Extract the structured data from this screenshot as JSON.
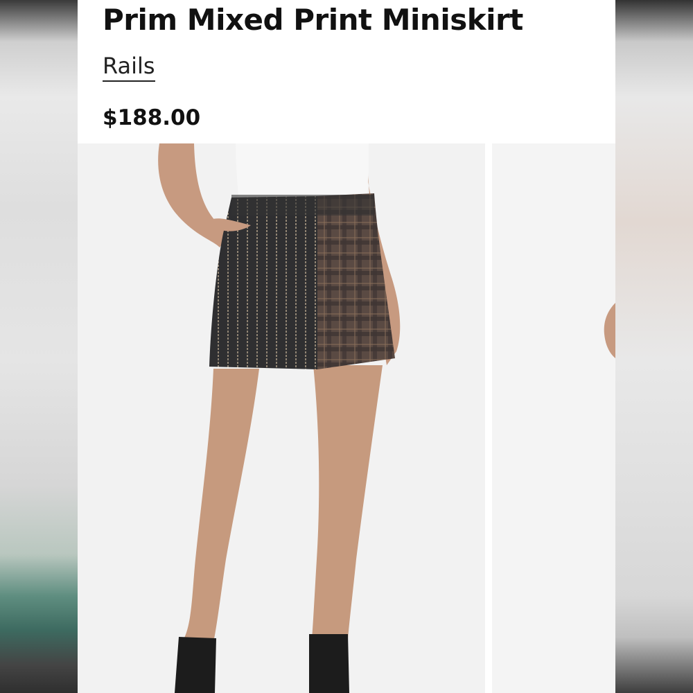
{
  "product": {
    "title": "Prim Mixed Print Miniskirt",
    "brand": "Rails",
    "price": "$188.00"
  },
  "gallery": {
    "images": [
      {
        "description": "Model wearing pinstripe and plaid mixed print miniskirt with white top and black boots"
      },
      {
        "description": "Partial view of next product image"
      }
    ]
  },
  "colors": {
    "text": "#111111",
    "card_background": "#ffffff",
    "photo_background": "#f2f2f2"
  }
}
